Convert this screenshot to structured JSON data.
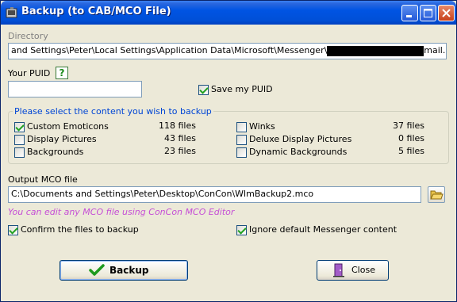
{
  "window": {
    "title": "Backup (to CAB/MCO File)",
    "colors": {
      "title_gradient_top": "#3a81f3",
      "title_gradient_bottom": "#0040c0",
      "face": "#ece9d8",
      "group_title": "#0046d5",
      "hint": "#c54fd6"
    }
  },
  "directory": {
    "label": "Directory",
    "value_prefix": "and Settings\\Peter\\Local Settings\\Application Data\\Microsoft\\Messenger\\",
    "value_suffix": "mail.com\\ObjectStore\\"
  },
  "puid": {
    "label": "Your PUID",
    "help_label": "?",
    "value": "",
    "save_label": "Save my PUID",
    "save_checked": true
  },
  "content": {
    "group_title": "Please select the content you wish to backup",
    "left": [
      {
        "label": "Custom Emoticons",
        "count": "118 files",
        "checked": true
      },
      {
        "label": "Display Pictures",
        "count": "43 files",
        "checked": false
      },
      {
        "label": "Backgrounds",
        "count": "23 files",
        "checked": false
      }
    ],
    "right": [
      {
        "label": "Winks",
        "count": "37 files",
        "checked": false
      },
      {
        "label": "Deluxe Display Pictures",
        "count": "0 files",
        "checked": false
      },
      {
        "label": "Dynamic Backgrounds",
        "count": "5 files",
        "checked": false
      }
    ]
  },
  "output": {
    "label": "Output MCO file",
    "value": "C:\\Documents and Settings\\Peter\\Desktop\\ConCon\\WlmBackup2.mco",
    "hint": "You can edit any MCO file using ConCon MCO Editor",
    "confirm_label": "Confirm the files to backup",
    "confirm_checked": true,
    "ignore_label": "Ignore default Messenger content",
    "ignore_checked": true
  },
  "buttons": {
    "backup": "Backup",
    "close": "Close"
  },
  "icons": {
    "title": "app-icon",
    "check": "green-checkmark-icon",
    "close": "exit-door-icon",
    "folder": "open-folder-icon"
  }
}
